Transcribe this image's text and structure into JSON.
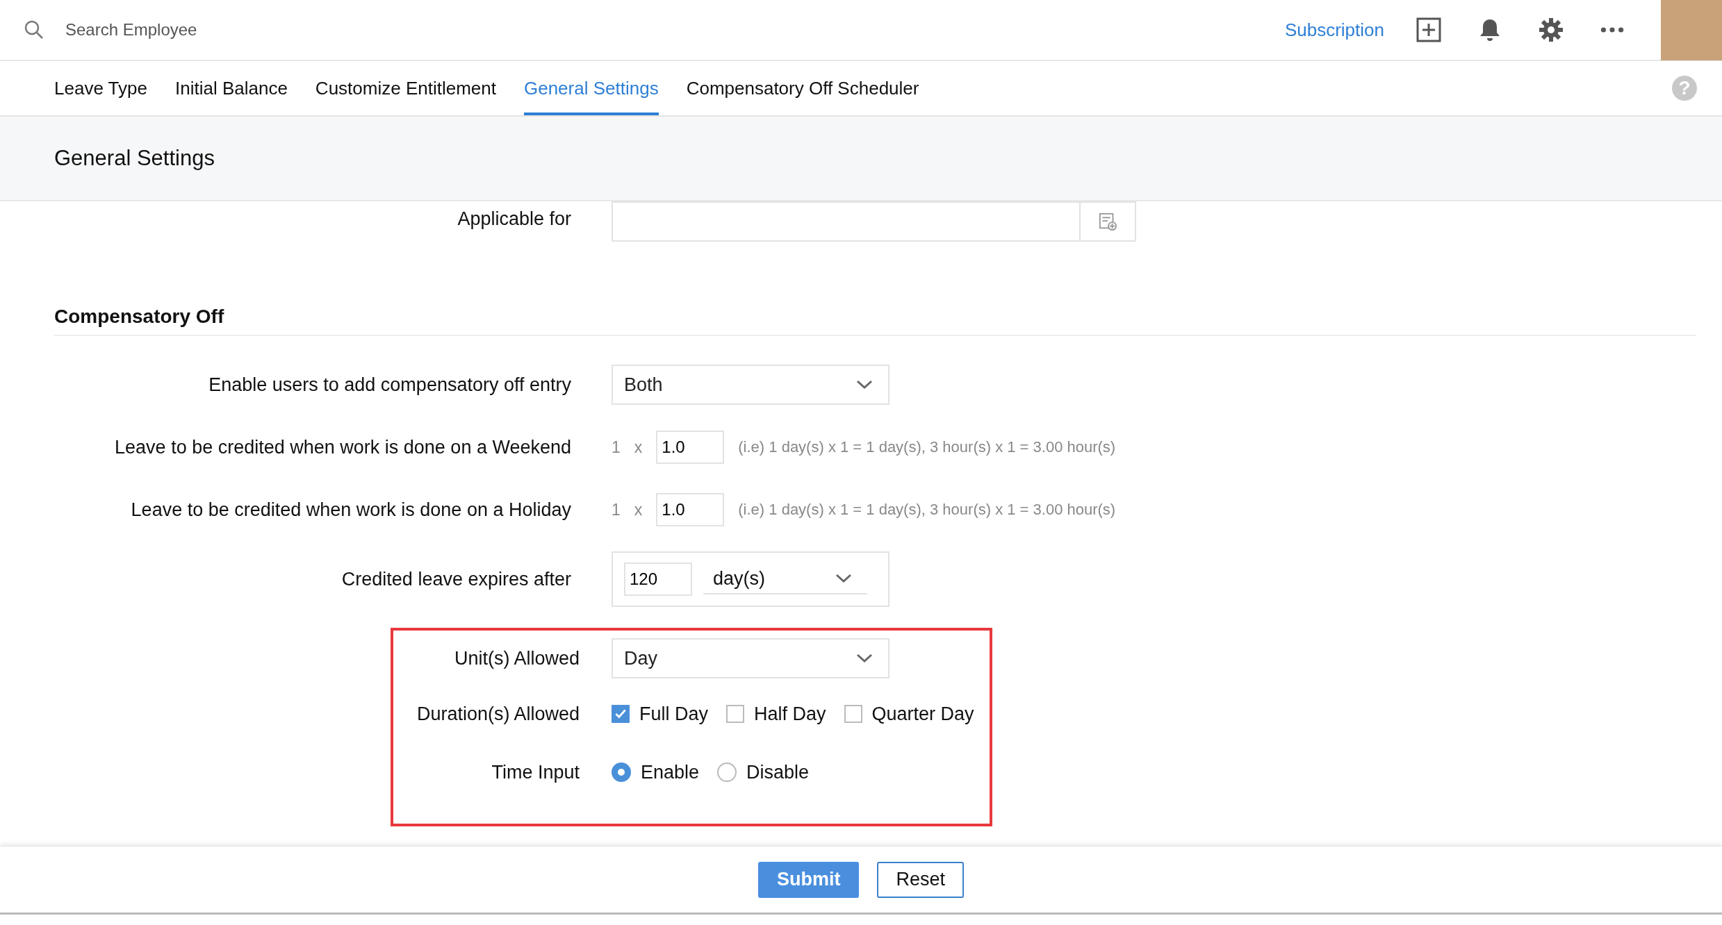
{
  "topbar": {
    "search": {
      "placeholder": "Search Employee"
    },
    "subscription": "Subscription"
  },
  "tabs": [
    {
      "label": "Leave Type",
      "selected": false
    },
    {
      "label": "Initial Balance",
      "selected": false
    },
    {
      "label": "Customize Entitlement",
      "selected": false
    },
    {
      "label": "General Settings",
      "selected": true
    },
    {
      "label": "Compensatory Off Scheduler",
      "selected": false
    }
  ],
  "help": "?",
  "page_title": "General Settings",
  "applicable_for": {
    "label": "Applicable for"
  },
  "section_title": "Compensatory Off",
  "fields": [
    {
      "kind": "select",
      "label": "Enable users to add compensatory off entry",
      "value": "Both"
    },
    {
      "kind": "multiplier",
      "label": "Leave to be credited when work is done on a Weekend",
      "base": "1",
      "times": "x",
      "value": "1.0",
      "hint": "(i.e) 1 day(s) x 1 = 1 day(s), 3 hour(s) x 1 = 3.00 hour(s)"
    },
    {
      "kind": "multiplier",
      "label": "Leave to be credited when work is done on a Holiday",
      "base": "1",
      "times": "x",
      "value": "1.0",
      "hint": "(i.e) 1 day(s) x 1 = 1 day(s), 3 hour(s) x 1 = 3.00 hour(s)"
    },
    {
      "kind": "expiry",
      "label": "Credited leave expires after",
      "value": "120",
      "unit": "day(s)"
    }
  ],
  "highlight_box": {
    "fields": [
      {
        "kind": "select",
        "label": "Unit(s) Allowed",
        "value": "Day"
      },
      {
        "kind": "checkboxes",
        "label": "Duration(s) Allowed",
        "options": [
          {
            "label": "Full Day",
            "checked": true
          },
          {
            "label": "Half Day",
            "checked": false
          },
          {
            "label": "Quarter Day",
            "checked": false
          }
        ]
      },
      {
        "kind": "radios",
        "label": "Time Input",
        "options": [
          {
            "label": "Enable",
            "selected": true
          },
          {
            "label": "Disable",
            "selected": false
          }
        ]
      }
    ]
  },
  "buttons": [
    {
      "kind": "primary",
      "label": "Submit"
    },
    {
      "kind": "secondary",
      "label": "Reset"
    }
  ]
}
